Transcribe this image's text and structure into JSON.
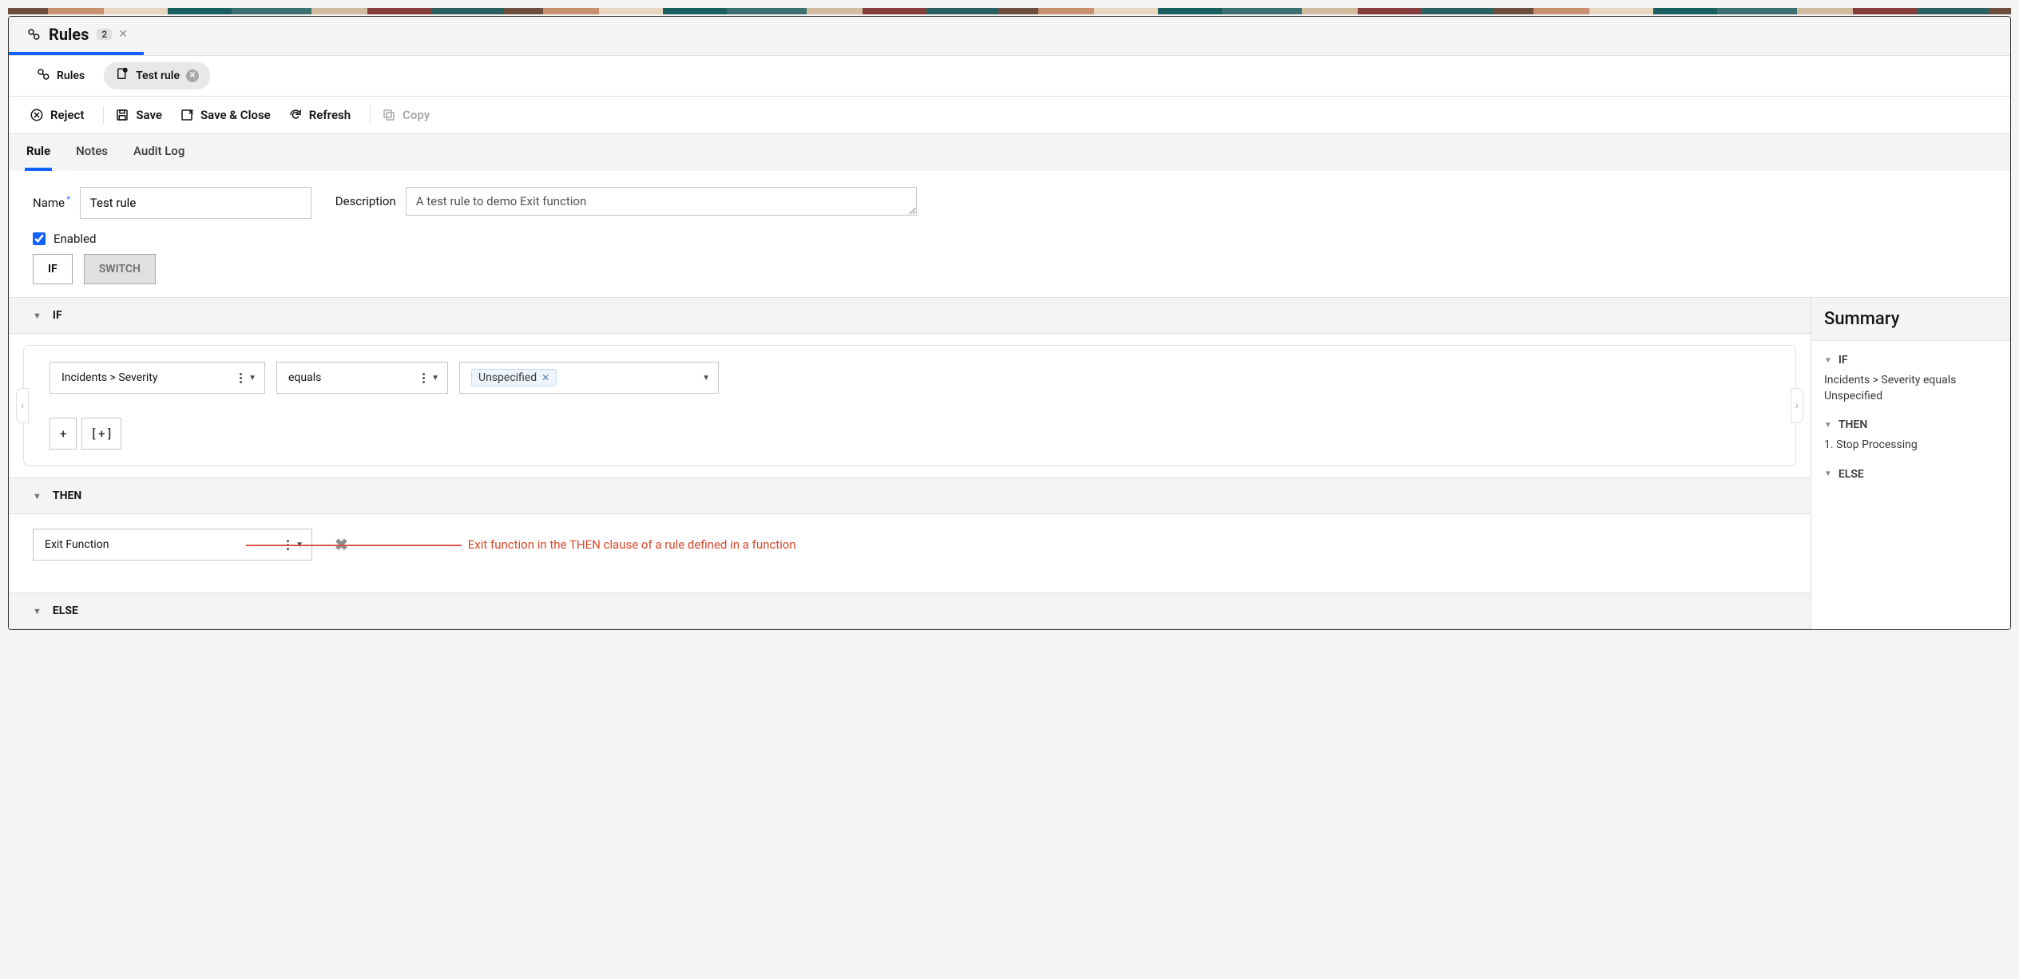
{
  "titleBar": {
    "title": "Rules",
    "badge": "2"
  },
  "subTabs": {
    "rules": "Rules",
    "testRule": "Test rule"
  },
  "actions": {
    "reject": "Reject",
    "save": "Save",
    "saveClose": "Save & Close",
    "refresh": "Refresh",
    "copy": "Copy"
  },
  "secondaryTabs": {
    "rule": "Rule",
    "notes": "Notes",
    "audit": "Audit Log"
  },
  "form": {
    "nameLabel": "Name",
    "nameValue": "Test rule",
    "descLabel": "Description",
    "descValue": "A test rule to demo Exit function",
    "enabledLabel": "Enabled"
  },
  "modes": {
    "if": "IF",
    "switch": "SWITCH"
  },
  "ifSection": {
    "header": "IF",
    "field": "Incidents > Severity",
    "operator": "equals",
    "valueTag": "Unspecified",
    "addBtn": "+",
    "addGroupBtn": "[ + ]"
  },
  "thenSection": {
    "header": "THEN",
    "action": "Exit Function"
  },
  "elseSection": {
    "header": "ELSE"
  },
  "annotation": "Exit function in the THEN clause of a rule defined in a function",
  "summary": {
    "title": "Summary",
    "ifTitle": "IF",
    "ifBody": "Incidents > Severity equals Unspecified",
    "thenTitle": "THEN",
    "thenBody": "1. Stop Processing",
    "elseTitle": "ELSE"
  }
}
